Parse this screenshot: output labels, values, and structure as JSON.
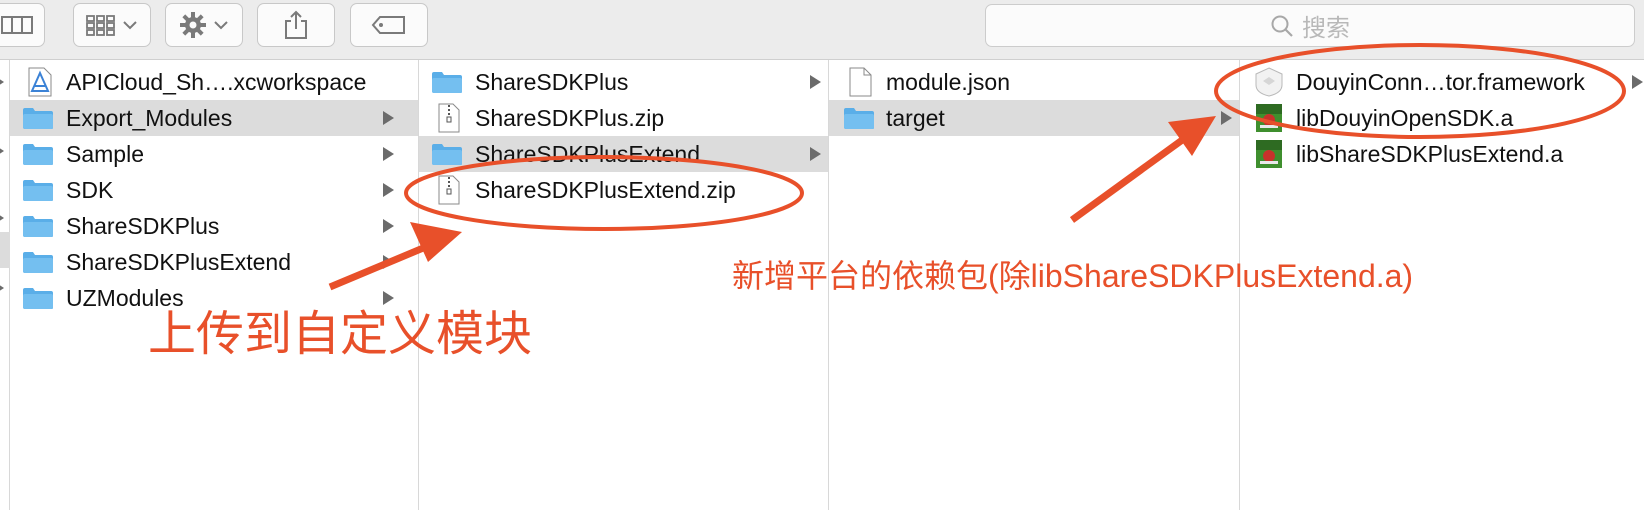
{
  "toolbar": {
    "search_placeholder": "搜索"
  },
  "columns": [
    {
      "items": [
        {
          "label": "APICloud_Sh….xcworkspace",
          "icon": "xcworkspace-icon",
          "selected": false,
          "has_children": false
        },
        {
          "label": "Export_Modules",
          "icon": "folder-icon",
          "selected": true,
          "has_children": true
        },
        {
          "label": "Sample",
          "icon": "folder-icon",
          "selected": false,
          "has_children": true
        },
        {
          "label": "SDK",
          "icon": "folder-icon",
          "selected": false,
          "has_children": true
        },
        {
          "label": "ShareSDKPlus",
          "icon": "folder-icon",
          "selected": false,
          "has_children": true
        },
        {
          "label": "ShareSDKPlusExtend",
          "icon": "folder-icon",
          "selected": false,
          "has_children": true
        },
        {
          "label": "UZModules",
          "icon": "folder-icon",
          "selected": false,
          "has_children": true
        }
      ]
    },
    {
      "items": [
        {
          "label": "ShareSDKPlus",
          "icon": "folder-icon",
          "selected": false,
          "has_children": true
        },
        {
          "label": "ShareSDKPlus.zip",
          "icon": "zip-file-icon",
          "selected": false,
          "has_children": false
        },
        {
          "label": "ShareSDKPlusExtend",
          "icon": "folder-icon",
          "selected": true,
          "has_children": true
        },
        {
          "label": "ShareSDKPlusExtend.zip",
          "icon": "zip-file-icon",
          "selected": false,
          "has_children": false
        }
      ]
    },
    {
      "items": [
        {
          "label": "module.json",
          "icon": "document-icon",
          "selected": false,
          "has_children": false
        },
        {
          "label": "target",
          "icon": "folder-icon",
          "selected": true,
          "has_children": true
        }
      ]
    },
    {
      "items": [
        {
          "label": "DouyinConn…tor.framework",
          "icon": "framework-icon",
          "selected": false,
          "has_children": true
        },
        {
          "label": "libDouyinOpenSDK.a",
          "icon": "static-library-icon",
          "selected": false,
          "has_children": false
        },
        {
          "label": "libShareSDKPlusExtend.a",
          "icon": "static-library-icon",
          "selected": false,
          "has_children": false
        }
      ]
    }
  ],
  "annotations": {
    "upload_note": "上传到自定义模块",
    "dependency_note": "新增平台的依赖包(除libShareSDKPlusExtend.a)"
  },
  "colors": {
    "annotation": "#e8502a",
    "folder": "#5aaee8",
    "selection": "#dcdcdc"
  }
}
